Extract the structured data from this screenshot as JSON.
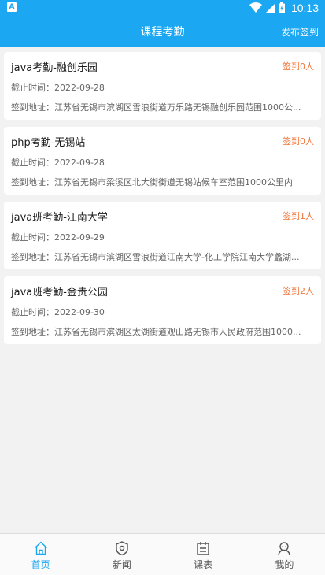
{
  "status_bar": {
    "time": "10:13",
    "left_icon": "A"
  },
  "app_bar": {
    "title": "课程考勤",
    "action": "发布签到"
  },
  "cards": [
    {
      "title": "java考勤-融创乐园",
      "count": "签到0人",
      "deadline": "截止时间：2022-09-28",
      "address": "签到地址：江苏省无锡市滨湖区雪浪街道万乐路无锡融创乐园范围1000公..."
    },
    {
      "title": "php考勤-无锡站",
      "count": "签到0人",
      "deadline": "截止时间：2022-09-28",
      "address": "签到地址：江苏省无锡市梁溪区北大街街道无锡站候车室范围1000公里内"
    },
    {
      "title": "java班考勤-江南大学",
      "count": "签到1人",
      "deadline": "截止时间：2022-09-29",
      "address": "签到地址：江苏省无锡市滨湖区雪浪街道江南大学-化工学院江南大学蠡湖..."
    },
    {
      "title": "java班考勤-金贵公园",
      "count": "签到2人",
      "deadline": "截止时间：2022-09-30",
      "address": "签到地址：江苏省无锡市滨湖区太湖街道观山路无锡市人民政府范围1000..."
    }
  ],
  "tabbar": {
    "items": [
      {
        "label": "首页",
        "icon": "home-icon"
      },
      {
        "label": "新闻",
        "icon": "news-icon"
      },
      {
        "label": "课表",
        "icon": "schedule-icon"
      },
      {
        "label": "我的",
        "icon": "profile-icon"
      }
    ],
    "active_index": 0
  },
  "colors": {
    "primary": "#1ba7f2",
    "count": "#f0763a",
    "background": "#f2f2f2"
  }
}
